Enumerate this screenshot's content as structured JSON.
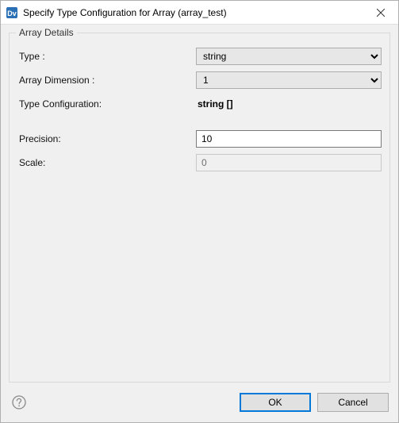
{
  "window": {
    "title": "Specify Type Configuration for Array (array_test)"
  },
  "group": {
    "title": "Array Details"
  },
  "labels": {
    "type": "Type :",
    "array_dimension": "Array Dimension :",
    "type_configuration": "Type Configuration:",
    "precision": "Precision:",
    "scale": "Scale:"
  },
  "values": {
    "type": "string",
    "array_dimension": "1",
    "type_configuration": "string []",
    "precision": "10",
    "scale": "0"
  },
  "buttons": {
    "ok": "OK",
    "cancel": "Cancel"
  }
}
